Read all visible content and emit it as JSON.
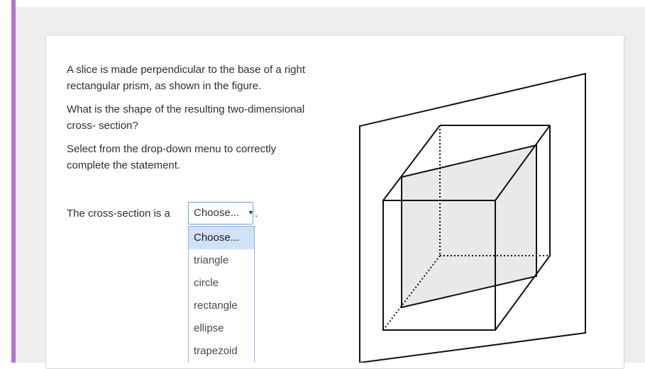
{
  "question": {
    "paragraphs": [
      "A slice is made perpendicular to the base of a right rectangular prism, as shown in the figure.",
      "What is the shape of the resulting two-dimensional cross- section?",
      "Select from the drop-down menu to correctly complete the statement."
    ],
    "statement_prefix": "The cross-section is a",
    "statement_suffix": "."
  },
  "dropdown": {
    "selected_label": "Choose...",
    "arrow_icon": "caret-down-icon",
    "options": [
      "Choose...",
      "triangle",
      "circle",
      "rectangle",
      "ellipse",
      "trapezoid"
    ],
    "highlighted_index": 0
  },
  "colors": {
    "accent_bar": "#b574d0",
    "page_background": "#eeeeee",
    "select_border": "#6b9fd6",
    "highlight": "#cfe2f7",
    "cross_section_fill": "#e9e9e9"
  }
}
